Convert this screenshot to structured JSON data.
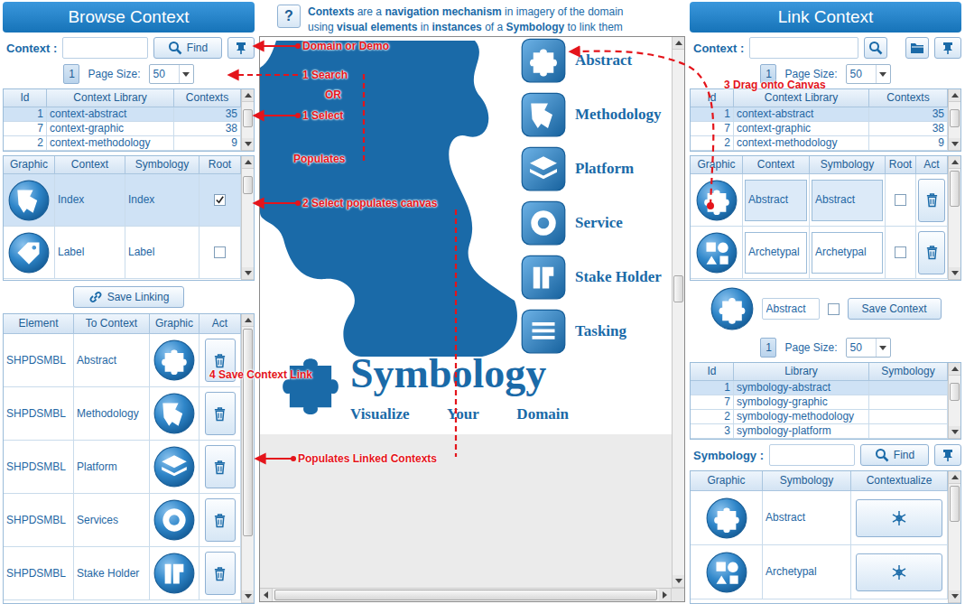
{
  "browse": {
    "title": "Browse Context",
    "search": {
      "label": "Context :",
      "value": "",
      "button": "Find"
    },
    "pager": {
      "page": "1",
      "page_size_label": "Page Size:",
      "page_size": "50"
    },
    "libraries": {
      "columns": [
        "Id",
        "Context Library",
        "Contexts"
      ],
      "rows": [
        {
          "id": "1",
          "library": "context-abstract",
          "count": "35",
          "selected": true
        },
        {
          "id": "7",
          "library": "context-graphic",
          "count": "38",
          "selected": false
        },
        {
          "id": "2",
          "library": "context-methodology",
          "count": "9",
          "selected": false
        }
      ]
    },
    "contexts": {
      "columns": [
        "Graphic",
        "Context",
        "Symbology",
        "Root"
      ],
      "rows": [
        {
          "context": "Index",
          "symbology": "Index",
          "root": true,
          "selected": true
        },
        {
          "context": "Label",
          "symbology": "Label",
          "root": false,
          "selected": false
        }
      ]
    },
    "save_button": "Save Linking",
    "links": {
      "columns": [
        "Element",
        "To Context",
        "Graphic",
        "Act"
      ],
      "rows": [
        {
          "element": "SHPDSMBL",
          "to": "Abstract"
        },
        {
          "element": "SHPDSMBL",
          "to": "Methodology"
        },
        {
          "element": "SHPDSMBL",
          "to": "Platform"
        },
        {
          "element": "SHPDSMBL",
          "to": "Services"
        },
        {
          "element": "SHPDSMBL",
          "to": "Stake Holder"
        }
      ]
    }
  },
  "help": {
    "icon": "?",
    "lines": [
      [
        {
          "text": "Contexts",
          "bold": true
        },
        {
          "text": " are a ",
          "bold": false
        },
        {
          "text": "navigation mechanism",
          "bold": true
        },
        {
          "text": " in imagery of the domain",
          "bold": false
        }
      ],
      [
        {
          "text": "using ",
          "bold": false
        },
        {
          "text": "visual elements",
          "bold": true
        },
        {
          "text": " in ",
          "bold": false
        },
        {
          "text": "instances",
          "bold": true
        },
        {
          "text": " of a ",
          "bold": false
        },
        {
          "text": "Symbology",
          "bold": true
        },
        {
          "text": " to link them",
          "bold": false
        }
      ]
    ]
  },
  "canvas": {
    "items": [
      "Abstract",
      "Methodology",
      "Platform",
      "Service",
      "Stake Holder",
      "Tasking"
    ],
    "logo": {
      "title": "Symbology",
      "tagline": [
        "Visualize",
        "Your",
        "Domain"
      ]
    }
  },
  "link": {
    "title": "Link Context",
    "search": {
      "label": "Context :",
      "value": ""
    },
    "pager": {
      "page": "1",
      "page_size_label": "Page Size:",
      "page_size": "50"
    },
    "libraries": {
      "columns": [
        "Id",
        "Context Library",
        "Contexts"
      ],
      "rows": [
        {
          "id": "1",
          "library": "context-abstract",
          "count": "35",
          "selected": true
        },
        {
          "id": "7",
          "library": "context-graphic",
          "count": "38",
          "selected": false
        },
        {
          "id": "2",
          "library": "context-methodology",
          "count": "9",
          "selected": false
        }
      ]
    },
    "contexts": {
      "columns": [
        "Graphic",
        "Context",
        "Symbology",
        "Root",
        "Act"
      ],
      "rows": [
        {
          "context": "Abstract",
          "symbology": "Abstract",
          "root": false,
          "selected": true
        },
        {
          "context": "Archetypal",
          "symbology": "Archetypal",
          "root": false,
          "selected": false
        }
      ]
    },
    "save": {
      "value": "Abstract",
      "root": false,
      "button": "Save Context"
    },
    "sym_pager": {
      "page": "1",
      "page_size_label": "Page Size:",
      "page_size": "50"
    },
    "sym_libraries": {
      "columns": [
        "Id",
        "Library",
        "Symbology"
      ],
      "rows": [
        {
          "id": "1",
          "library": "symbology-abstract",
          "symbology": "",
          "selected": true
        },
        {
          "id": "7",
          "library": "symbology-graphic",
          "symbology": "",
          "selected": false
        },
        {
          "id": "2",
          "library": "symbology-methodology",
          "symbology": "",
          "selected": false
        },
        {
          "id": "3",
          "library": "symbology-platform",
          "symbology": "",
          "selected": false
        }
      ]
    },
    "sym_search": {
      "label": "Symbology :",
      "value": "",
      "button": "Find"
    },
    "symbologies": {
      "columns": [
        "Graphic",
        "Symbology",
        "Contextualize"
      ],
      "rows": [
        {
          "symbology": "Abstract"
        },
        {
          "symbology": "Archetypal"
        }
      ]
    }
  },
  "annotations": [
    {
      "text": "Domain or Demo"
    },
    {
      "text": "1 Search"
    },
    {
      "text": "OR"
    },
    {
      "text": "1 Select"
    },
    {
      "text": "Populates"
    },
    {
      "text": "2 Select populates canvas"
    },
    {
      "text": "3 Drag onto Canvas"
    },
    {
      "text": "4 Save Context Link"
    },
    {
      "text": "Populates Linked Contexts"
    }
  ]
}
